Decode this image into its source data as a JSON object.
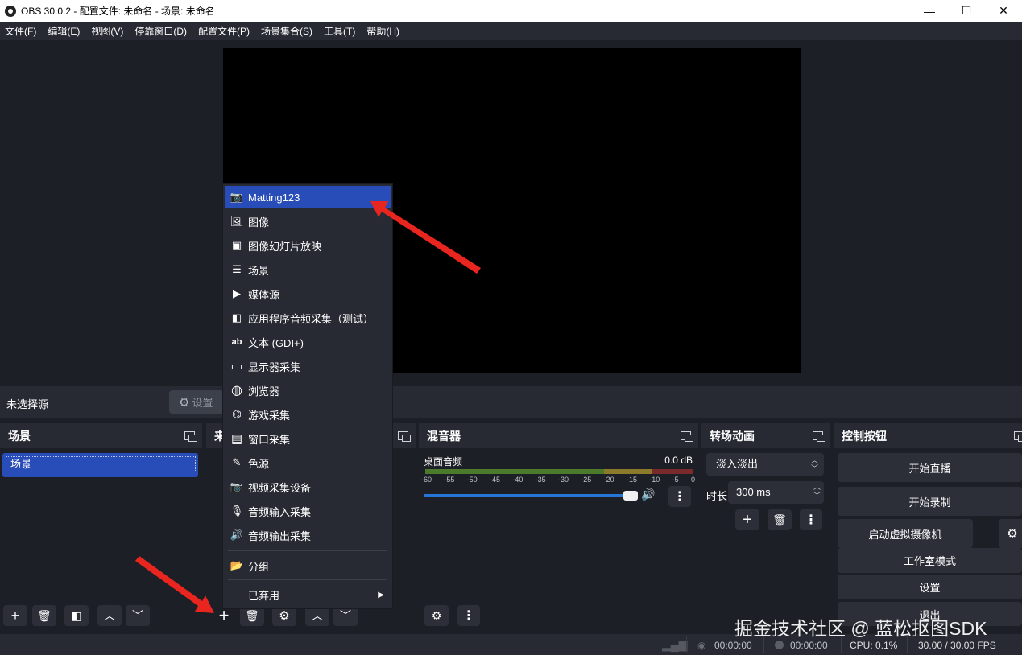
{
  "window": {
    "title": "OBS 30.0.2 - 配置文件: 未命名 - 场景: 未命名",
    "minimize": "—",
    "maximize": "☐",
    "close": "✕"
  },
  "menu": [
    "文件(F)",
    "编辑(E)",
    "视图(V)",
    "停靠窗口(D)",
    "配置文件(P)",
    "场景集合(S)",
    "工具(T)",
    "帮助(H)"
  ],
  "source_toolbar": {
    "no_source": "未选择源",
    "settings_label": "设置"
  },
  "docks": {
    "scenes": {
      "title": "场景",
      "items": [
        "场景"
      ]
    },
    "sources": {
      "title": "来"
    },
    "mixer": {
      "title": "混音器",
      "channel": "桌面音频",
      "level": "0.0 dB",
      "scale": [
        "-60",
        "-55",
        "-50",
        "-45",
        "-40",
        "-35",
        "-30",
        "-25",
        "-20",
        "-15",
        "-10",
        "-5",
        "0"
      ],
      "volume": 1.0
    },
    "transitions": {
      "title": "转场动画",
      "selected": "淡入淡出",
      "duration_label": "时长",
      "duration": "300 ms"
    },
    "controls": {
      "title": "控制按钮",
      "buttons": [
        "开始直播",
        "开始录制",
        "启动虚拟摄像机",
        "工作室模式",
        "设置",
        "退出"
      ]
    }
  },
  "context_menu": {
    "items": [
      {
        "label": "Matting123",
        "icon": "camera-icon",
        "glyph": "📷"
      },
      {
        "label": "图像",
        "icon": "image-icon",
        "glyph": "🖼"
      },
      {
        "label": "图像幻灯片放映",
        "icon": "slideshow-icon",
        "glyph": "▣"
      },
      {
        "label": "场景",
        "icon": "list-icon",
        "glyph": "☰"
      },
      {
        "label": "媒体源",
        "icon": "play-icon",
        "glyph": "▶"
      },
      {
        "label": "应用程序音频采集（测试）",
        "icon": "app-audio-icon",
        "glyph": "◧"
      },
      {
        "label": "文本 (GDI+)",
        "icon": "text-icon",
        "glyph": "ab"
      },
      {
        "label": "显示器采集",
        "icon": "monitor-icon",
        "glyph": "▭"
      },
      {
        "label": "浏览器",
        "icon": "globe-icon",
        "glyph": "◍"
      },
      {
        "label": "游戏采集",
        "icon": "gamepad-icon",
        "glyph": "⌬"
      },
      {
        "label": "窗口采集",
        "icon": "window-icon",
        "glyph": "▤"
      },
      {
        "label": "色源",
        "icon": "brush-icon",
        "glyph": "✎"
      },
      {
        "label": "视频采集设备",
        "icon": "camera-icon",
        "glyph": "📷"
      },
      {
        "label": "音频输入采集",
        "icon": "microphone-icon",
        "glyph": "🎙"
      },
      {
        "label": "音频输出采集",
        "icon": "speaker-icon",
        "glyph": "🔊"
      }
    ],
    "group": {
      "label": "分组",
      "icon": "folder-icon",
      "glyph": "📂"
    },
    "deprecated": {
      "label": "已弃用",
      "arrow": "▶"
    }
  },
  "status": {
    "stream_time": "00:00:00",
    "record_time": "00:00:00",
    "cpu": "CPU: 0.1%",
    "fps": "30.00 / 30.00 FPS"
  },
  "watermark": "掘金技术社区 @ 蓝松抠图SDK",
  "colors": {
    "accent": "#284cb8",
    "background": "#1d1f26",
    "panel": "#272a33",
    "arrow": "#e8251f"
  }
}
